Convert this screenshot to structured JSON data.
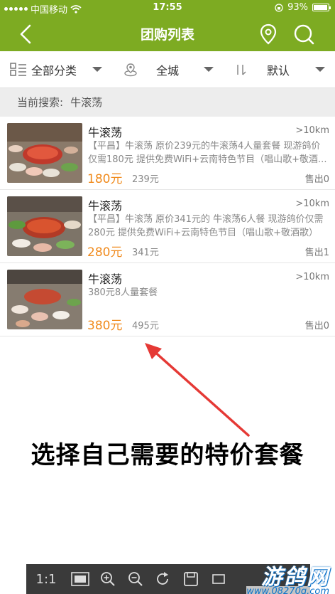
{
  "status_bar": {
    "carrier": "中国移动",
    "time": "17:55",
    "battery": "93%",
    "battery_level": 0.93
  },
  "nav": {
    "title": "团购列表"
  },
  "filters": {
    "category": "全部分类",
    "area": "全城",
    "sort": "默认"
  },
  "current_search": {
    "label": "当前搜索:",
    "keyword": "牛滚荡"
  },
  "deals": [
    {
      "title": "牛滚荡",
      "distance": ">10km",
      "description": "【平昌】牛滚荡 原价239元的牛滚荡4人量套餐  现游鸽价仅需180元 提供免费WiFi+云南特色节目（唱山歌+敬酒...",
      "price": "180元",
      "original_price": "239元",
      "sold": "售出0"
    },
    {
      "title": "牛滚荡",
      "distance": ">10km",
      "description": "【平昌】牛滚荡 原价341元的 牛滚荡6人餐  现游鸽价仅需280元 提供免费WiFi+云南特色节目（唱山歌+敬酒歌）",
      "price": "280元",
      "original_price": "341元",
      "sold": "售出1"
    },
    {
      "title": "牛滚荡",
      "distance": ">10km",
      "description": "380元8人量套餐",
      "price": "380元",
      "original_price": "495元",
      "sold": "售出0"
    }
  ],
  "annotation": "选择自己需要的特价套餐",
  "viewer_toolbar": {
    "ratio": "1:1"
  },
  "watermark": {
    "main": "游鸽网",
    "sub": "www.08270g.com"
  },
  "colors": {
    "header_green": "#7dab22",
    "price_orange": "#f08a1c",
    "arrow_red": "#e53935"
  }
}
